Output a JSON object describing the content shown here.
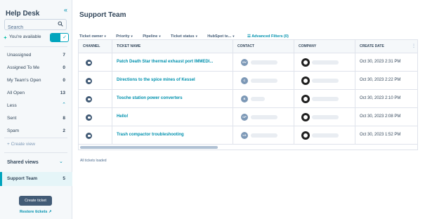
{
  "sidebar": {
    "title": "Help Desk",
    "search_placeholder": "Search",
    "availability_label": "You're available",
    "views": [
      {
        "label": "Unassigned",
        "count": "7"
      },
      {
        "label": "Assigned To Me",
        "count": "0"
      },
      {
        "label": "My Team's Open",
        "count": "0"
      },
      {
        "label": "All Open",
        "count": "13"
      },
      {
        "label": "Less",
        "count": ""
      },
      {
        "label": "Sent",
        "count": "8"
      },
      {
        "label": "Spam",
        "count": "2"
      }
    ],
    "create_view": "+ Create view",
    "shared_views": "Shared views",
    "support_team": {
      "label": "Support Team",
      "count": "5"
    },
    "create_ticket": "Create ticket",
    "restore_tickets": "Restore tickets"
  },
  "main": {
    "title": "Support Team",
    "filters": [
      "Ticket owner",
      "Priority",
      "Pipeline",
      "Ticket status",
      "HubSpot te..."
    ],
    "advanced_filters": "Advanced Filters (0)",
    "columns": [
      "CHANNEL",
      "TICKET NAME",
      "CONTACT",
      "COMPANY",
      "CREATE DATE"
    ],
    "rows": [
      {
        "name": "Patch Death Star thermal exhaust port IMMEDI...",
        "initials": "DV",
        "date": "Oct 30, 2023 2:31 PM"
      },
      {
        "name": "Directions to the spice mines of Kessel",
        "initials": "C",
        "date": "Oct 30, 2023 2:22 PM"
      },
      {
        "name": "Tosche station power converters",
        "initials": "B",
        "date": "Oct 30, 2023 2:10 PM"
      },
      {
        "name": "Hello!",
        "initials": "CP",
        "date": "Oct 30, 2023 2:08 PM"
      },
      {
        "name": "Trash compactor troubleshooting",
        "initials": "LS",
        "date": "Oct 30, 2023 1:52 PM"
      }
    ],
    "status": "All tickets loaded"
  },
  "colors": {
    "accent": "#00a4bd",
    "link": "#0091ae",
    "text": "#33475b",
    "button": "#425b76"
  }
}
